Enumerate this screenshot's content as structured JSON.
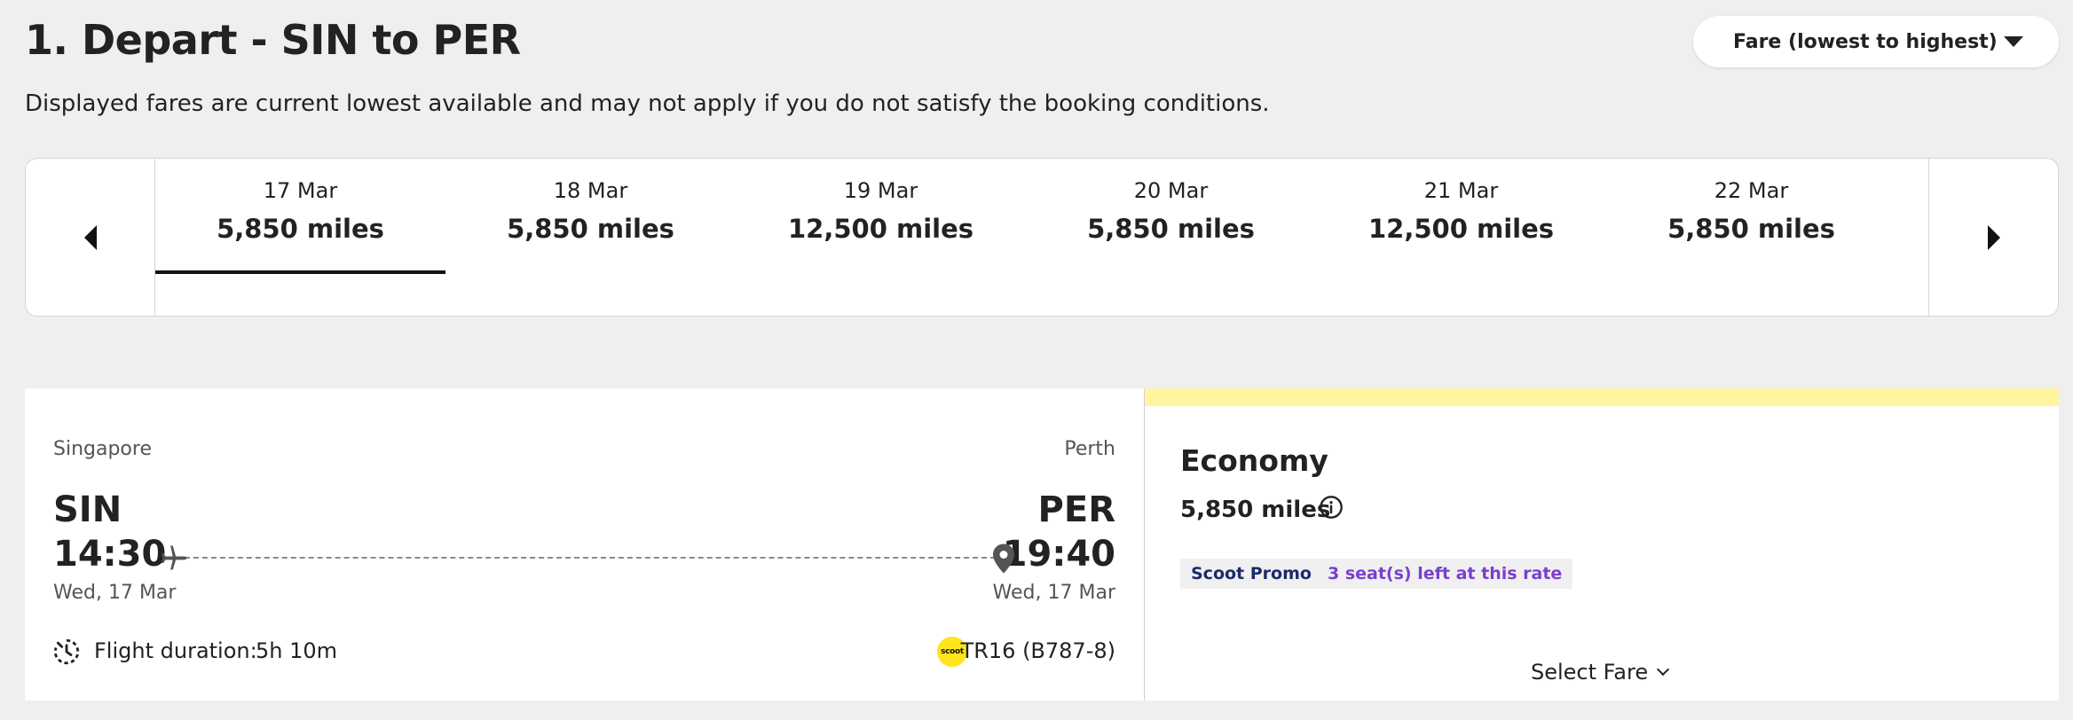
{
  "page": {
    "title": "1. Depart - SIN to PER",
    "subtitle": "Displayed fares are current lowest available and may not apply if you do not satisfy the booking conditions."
  },
  "sort": {
    "selected": "Fare (lowest to highest)",
    "icon": "caret-down-icon"
  },
  "date_strip": {
    "prev_icon": "chevron-left-icon",
    "next_icon": "chevron-right-icon",
    "active_index": 0,
    "dates": [
      {
        "date": "17 Mar",
        "miles": "5,850 miles"
      },
      {
        "date": "18 Mar",
        "miles": "5,850 miles"
      },
      {
        "date": "19 Mar",
        "miles": "12,500 miles"
      },
      {
        "date": "20 Mar",
        "miles": "5,850 miles"
      },
      {
        "date": "21 Mar",
        "miles": "12,500 miles"
      },
      {
        "date": "22 Mar",
        "miles": "5,850 miles"
      }
    ]
  },
  "flight": {
    "origin": {
      "city": "Singapore",
      "code": "SIN",
      "time": "14:30",
      "date": "Wed, 17 Mar"
    },
    "destination": {
      "city": "Perth",
      "code": "PER",
      "time": "19:40",
      "date": "Wed, 17 Mar"
    },
    "duration_label": "Flight duration:",
    "duration": "5h 10m",
    "airline_logo_text": "scoot",
    "flight_number": "TR16 (B787-8)"
  },
  "fare": {
    "cabin": "Economy",
    "miles": "5,850 miles",
    "badges": {
      "promo": "Scoot Promo",
      "seats": "3 seat(s) left at this rate"
    },
    "select_label": "Select Fare",
    "colors": {
      "accent_band": "#fff5a0",
      "promo_text": "#1a2a6c",
      "seats_text": "#7b3fd0"
    }
  }
}
